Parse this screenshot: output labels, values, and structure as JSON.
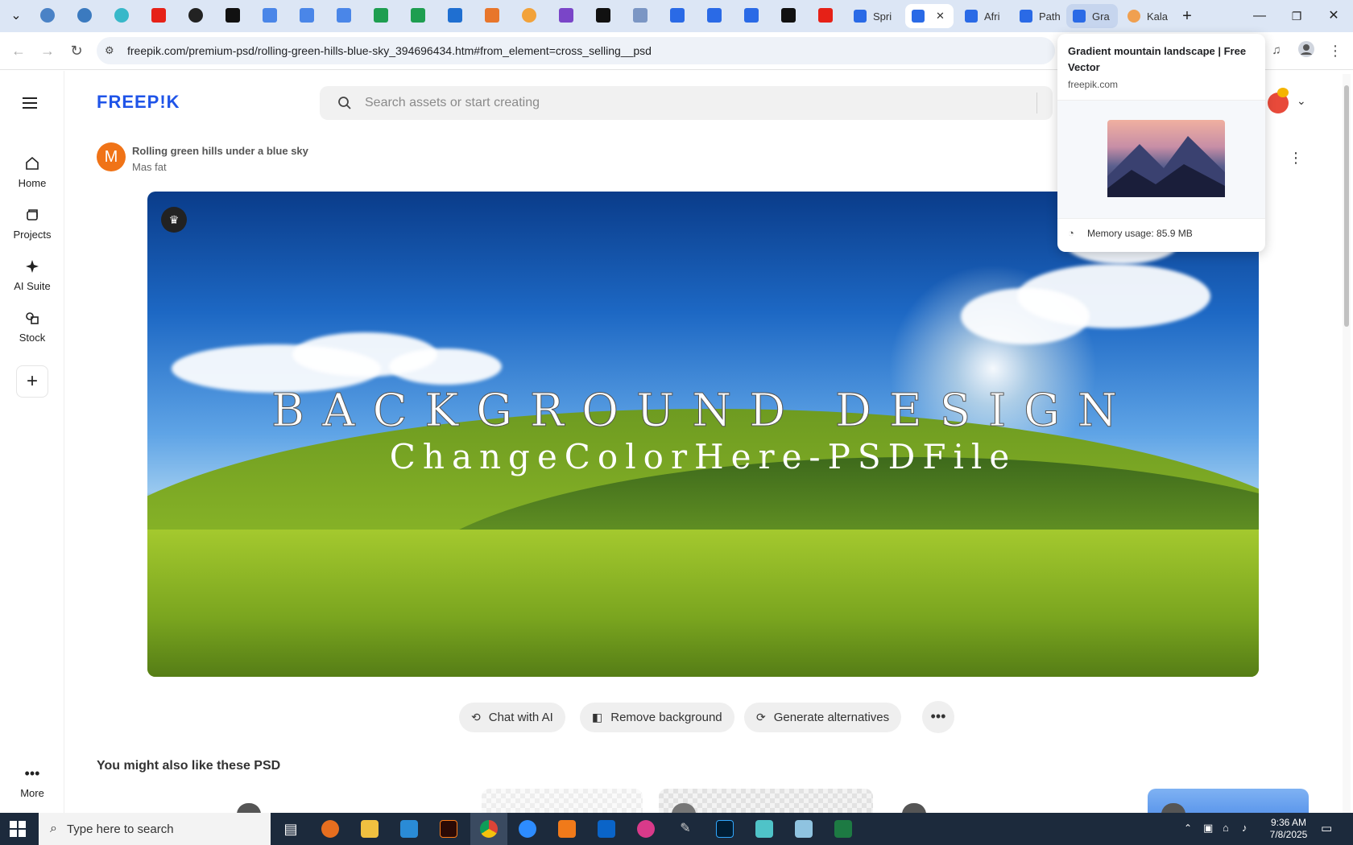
{
  "browser": {
    "tabs": [
      {
        "label": "Spri",
        "active": false
      },
      {
        "label": "",
        "active": true
      },
      {
        "label": "Afri",
        "active": false
      },
      {
        "label": "Path",
        "active": false
      },
      {
        "label": "Gra",
        "active": false,
        "hover": true
      },
      {
        "label": "Kala",
        "active": false
      }
    ],
    "tab_close": "✕",
    "new_tab": "+",
    "address": "freepik.com/premium-psd/rolling-green-hills-blue-sky_394696434.htm#from_element=cross_selling__psd"
  },
  "sidebar": {
    "items": [
      {
        "label": "Home"
      },
      {
        "label": "Projects"
      },
      {
        "label": "AI Suite"
      },
      {
        "label": "Stock"
      }
    ],
    "add": "+",
    "more": "More"
  },
  "header": {
    "logo": "FREEP!K",
    "search_placeholder": "Search assets or start creating"
  },
  "asset": {
    "avatar_letter": "M",
    "title": "Rolling green hills under a blue sky",
    "author": "Mas fat",
    "hero_line1": "BACKGROUND DESIGN",
    "hero_line2": "ChangeColorHere-PSDFile"
  },
  "actions": {
    "chat": "Chat with AI",
    "remove_bg": "Remove background",
    "alternatives": "Generate alternatives",
    "more": "•••"
  },
  "related": {
    "title": "You might also like these PSD"
  },
  "hovercard": {
    "title": "Gradient mountain landscape | Free Vector",
    "domain": "freepik.com",
    "memory": "Memory usage: 85.9 MB"
  },
  "taskbar": {
    "search_placeholder": "Type here to search",
    "time": "9:36 AM",
    "date": "7/8/2025"
  }
}
